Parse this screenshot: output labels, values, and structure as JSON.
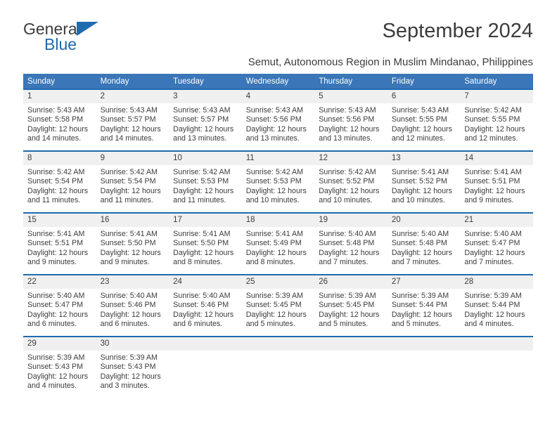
{
  "brand": {
    "name_part1": "General",
    "name_part2": "Blue",
    "accent_color": "#1f6bb0"
  },
  "header": {
    "month_title": "September 2024",
    "location_subtitle": "Semut, Autonomous Region in Muslim Mindanao, Philippines"
  },
  "calendar": {
    "header_color": "#3a76b8",
    "daynum_background": "#f0f0f0",
    "weekday_names": [
      "Sunday",
      "Monday",
      "Tuesday",
      "Wednesday",
      "Thursday",
      "Friday",
      "Saturday"
    ],
    "weeks": [
      [
        {
          "day": "1",
          "sunrise": "Sunrise: 5:43 AM",
          "sunset": "Sunset: 5:58 PM",
          "daylight_line1": "Daylight: 12 hours",
          "daylight_line2": "and 14 minutes."
        },
        {
          "day": "2",
          "sunrise": "Sunrise: 5:43 AM",
          "sunset": "Sunset: 5:57 PM",
          "daylight_line1": "Daylight: 12 hours",
          "daylight_line2": "and 14 minutes."
        },
        {
          "day": "3",
          "sunrise": "Sunrise: 5:43 AM",
          "sunset": "Sunset: 5:57 PM",
          "daylight_line1": "Daylight: 12 hours",
          "daylight_line2": "and 13 minutes."
        },
        {
          "day": "4",
          "sunrise": "Sunrise: 5:43 AM",
          "sunset": "Sunset: 5:56 PM",
          "daylight_line1": "Daylight: 12 hours",
          "daylight_line2": "and 13 minutes."
        },
        {
          "day": "5",
          "sunrise": "Sunrise: 5:43 AM",
          "sunset": "Sunset: 5:56 PM",
          "daylight_line1": "Daylight: 12 hours",
          "daylight_line2": "and 13 minutes."
        },
        {
          "day": "6",
          "sunrise": "Sunrise: 5:43 AM",
          "sunset": "Sunset: 5:55 PM",
          "daylight_line1": "Daylight: 12 hours",
          "daylight_line2": "and 12 minutes."
        },
        {
          "day": "7",
          "sunrise": "Sunrise: 5:42 AM",
          "sunset": "Sunset: 5:55 PM",
          "daylight_line1": "Daylight: 12 hours",
          "daylight_line2": "and 12 minutes."
        }
      ],
      [
        {
          "day": "8",
          "sunrise": "Sunrise: 5:42 AM",
          "sunset": "Sunset: 5:54 PM",
          "daylight_line1": "Daylight: 12 hours",
          "daylight_line2": "and 11 minutes."
        },
        {
          "day": "9",
          "sunrise": "Sunrise: 5:42 AM",
          "sunset": "Sunset: 5:54 PM",
          "daylight_line1": "Daylight: 12 hours",
          "daylight_line2": "and 11 minutes."
        },
        {
          "day": "10",
          "sunrise": "Sunrise: 5:42 AM",
          "sunset": "Sunset: 5:53 PM",
          "daylight_line1": "Daylight: 12 hours",
          "daylight_line2": "and 11 minutes."
        },
        {
          "day": "11",
          "sunrise": "Sunrise: 5:42 AM",
          "sunset": "Sunset: 5:53 PM",
          "daylight_line1": "Daylight: 12 hours",
          "daylight_line2": "and 10 minutes."
        },
        {
          "day": "12",
          "sunrise": "Sunrise: 5:42 AM",
          "sunset": "Sunset: 5:52 PM",
          "daylight_line1": "Daylight: 12 hours",
          "daylight_line2": "and 10 minutes."
        },
        {
          "day": "13",
          "sunrise": "Sunrise: 5:41 AM",
          "sunset": "Sunset: 5:52 PM",
          "daylight_line1": "Daylight: 12 hours",
          "daylight_line2": "and 10 minutes."
        },
        {
          "day": "14",
          "sunrise": "Sunrise: 5:41 AM",
          "sunset": "Sunset: 5:51 PM",
          "daylight_line1": "Daylight: 12 hours",
          "daylight_line2": "and 9 minutes."
        }
      ],
      [
        {
          "day": "15",
          "sunrise": "Sunrise: 5:41 AM",
          "sunset": "Sunset: 5:51 PM",
          "daylight_line1": "Daylight: 12 hours",
          "daylight_line2": "and 9 minutes."
        },
        {
          "day": "16",
          "sunrise": "Sunrise: 5:41 AM",
          "sunset": "Sunset: 5:50 PM",
          "daylight_line1": "Daylight: 12 hours",
          "daylight_line2": "and 9 minutes."
        },
        {
          "day": "17",
          "sunrise": "Sunrise: 5:41 AM",
          "sunset": "Sunset: 5:50 PM",
          "daylight_line1": "Daylight: 12 hours",
          "daylight_line2": "and 8 minutes."
        },
        {
          "day": "18",
          "sunrise": "Sunrise: 5:41 AM",
          "sunset": "Sunset: 5:49 PM",
          "daylight_line1": "Daylight: 12 hours",
          "daylight_line2": "and 8 minutes."
        },
        {
          "day": "19",
          "sunrise": "Sunrise: 5:40 AM",
          "sunset": "Sunset: 5:48 PM",
          "daylight_line1": "Daylight: 12 hours",
          "daylight_line2": "and 7 minutes."
        },
        {
          "day": "20",
          "sunrise": "Sunrise: 5:40 AM",
          "sunset": "Sunset: 5:48 PM",
          "daylight_line1": "Daylight: 12 hours",
          "daylight_line2": "and 7 minutes."
        },
        {
          "day": "21",
          "sunrise": "Sunrise: 5:40 AM",
          "sunset": "Sunset: 5:47 PM",
          "daylight_line1": "Daylight: 12 hours",
          "daylight_line2": "and 7 minutes."
        }
      ],
      [
        {
          "day": "22",
          "sunrise": "Sunrise: 5:40 AM",
          "sunset": "Sunset: 5:47 PM",
          "daylight_line1": "Daylight: 12 hours",
          "daylight_line2": "and 6 minutes."
        },
        {
          "day": "23",
          "sunrise": "Sunrise: 5:40 AM",
          "sunset": "Sunset: 5:46 PM",
          "daylight_line1": "Daylight: 12 hours",
          "daylight_line2": "and 6 minutes."
        },
        {
          "day": "24",
          "sunrise": "Sunrise: 5:40 AM",
          "sunset": "Sunset: 5:46 PM",
          "daylight_line1": "Daylight: 12 hours",
          "daylight_line2": "and 6 minutes."
        },
        {
          "day": "25",
          "sunrise": "Sunrise: 5:39 AM",
          "sunset": "Sunset: 5:45 PM",
          "daylight_line1": "Daylight: 12 hours",
          "daylight_line2": "and 5 minutes."
        },
        {
          "day": "26",
          "sunrise": "Sunrise: 5:39 AM",
          "sunset": "Sunset: 5:45 PM",
          "daylight_line1": "Daylight: 12 hours",
          "daylight_line2": "and 5 minutes."
        },
        {
          "day": "27",
          "sunrise": "Sunrise: 5:39 AM",
          "sunset": "Sunset: 5:44 PM",
          "daylight_line1": "Daylight: 12 hours",
          "daylight_line2": "and 5 minutes."
        },
        {
          "day": "28",
          "sunrise": "Sunrise: 5:39 AM",
          "sunset": "Sunset: 5:44 PM",
          "daylight_line1": "Daylight: 12 hours",
          "daylight_line2": "and 4 minutes."
        }
      ],
      [
        {
          "day": "29",
          "sunrise": "Sunrise: 5:39 AM",
          "sunset": "Sunset: 5:43 PM",
          "daylight_line1": "Daylight: 12 hours",
          "daylight_line2": "and 4 minutes."
        },
        {
          "day": "30",
          "sunrise": "Sunrise: 5:39 AM",
          "sunset": "Sunset: 5:43 PM",
          "daylight_line1": "Daylight: 12 hours",
          "daylight_line2": "and 3 minutes."
        },
        {
          "day": "",
          "sunrise": "",
          "sunset": "",
          "daylight_line1": "",
          "daylight_line2": ""
        },
        {
          "day": "",
          "sunrise": "",
          "sunset": "",
          "daylight_line1": "",
          "daylight_line2": ""
        },
        {
          "day": "",
          "sunrise": "",
          "sunset": "",
          "daylight_line1": "",
          "daylight_line2": ""
        },
        {
          "day": "",
          "sunrise": "",
          "sunset": "",
          "daylight_line1": "",
          "daylight_line2": ""
        },
        {
          "day": "",
          "sunrise": "",
          "sunset": "",
          "daylight_line1": "",
          "daylight_line2": ""
        }
      ]
    ]
  }
}
